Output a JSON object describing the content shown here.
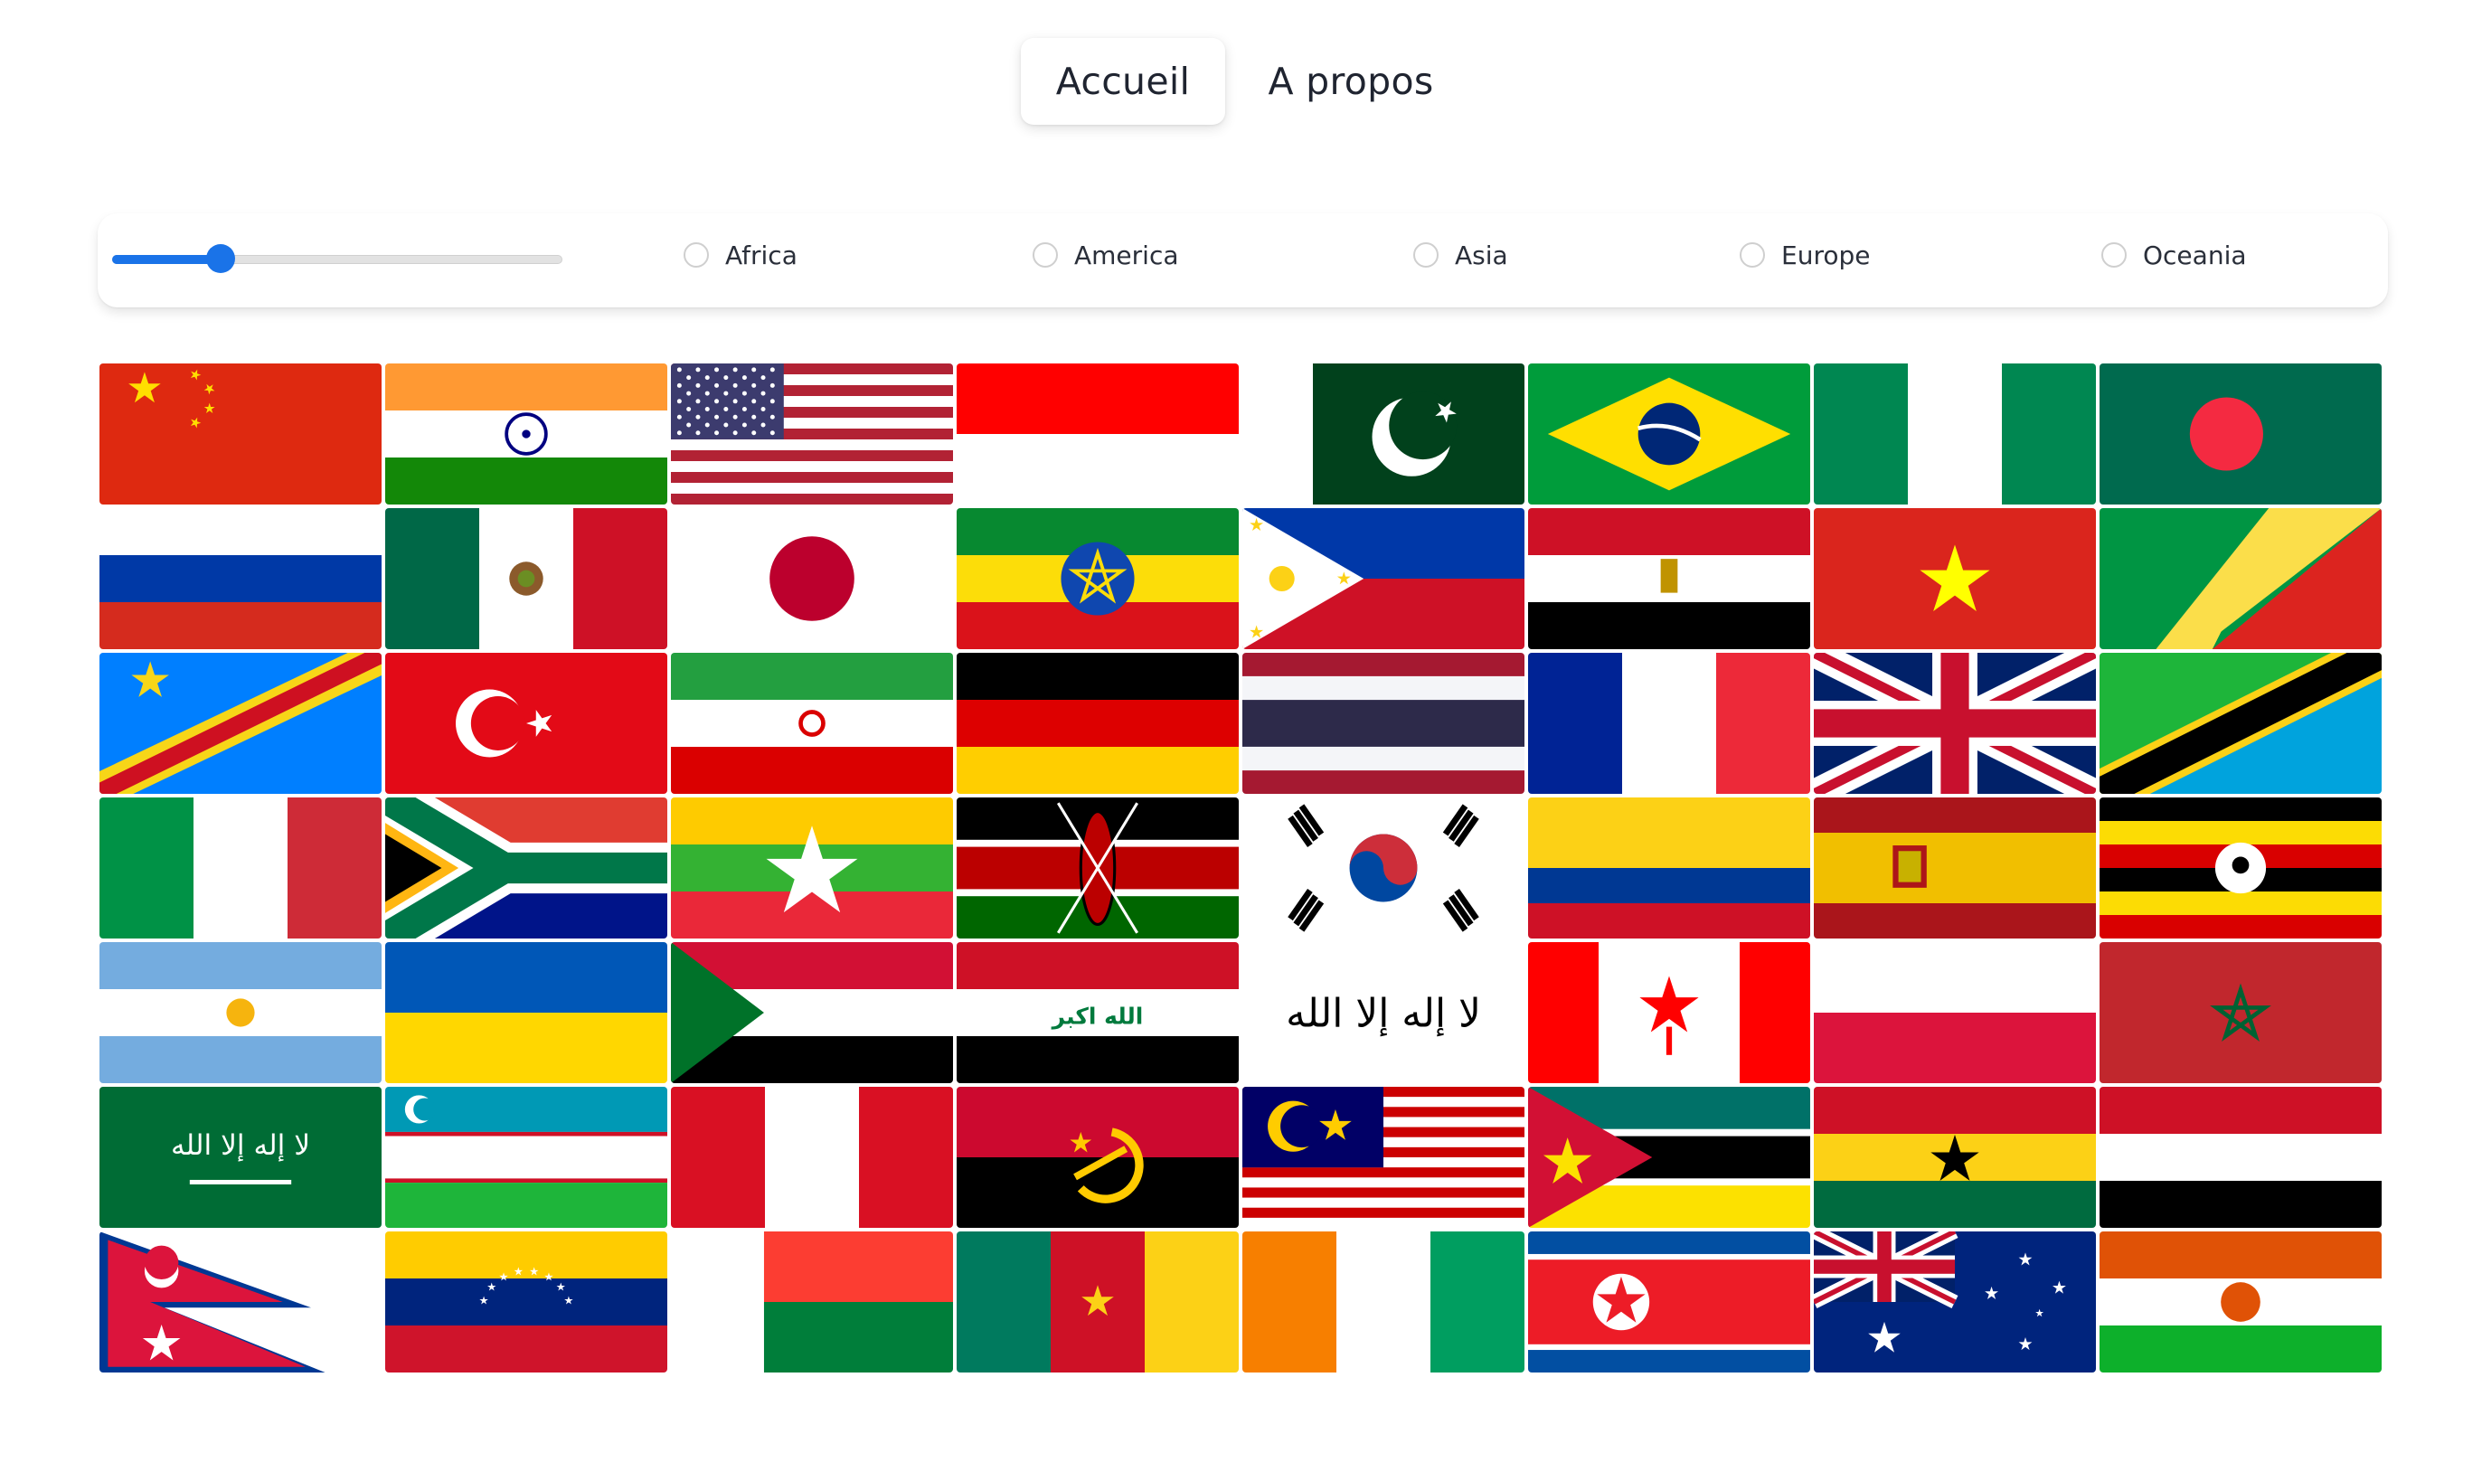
{
  "nav": {
    "home_label": "Accueil",
    "about_label": "A propos"
  },
  "filters": {
    "slider_level": 0.24,
    "regions": [
      {
        "label": "Africa",
        "checked": false
      },
      {
        "label": "America",
        "checked": false
      },
      {
        "label": "Asia",
        "checked": false
      },
      {
        "label": "Europe",
        "checked": false
      },
      {
        "label": "Oceania",
        "checked": false
      }
    ]
  },
  "flags": [
    "china",
    "india",
    "usa",
    "indonesia",
    "pakistan",
    "brazil",
    "nigeria",
    "bangladesh",
    "russia",
    "mexico",
    "japan",
    "ethiopia",
    "philippines",
    "egypt",
    "vietnam",
    "republic-of-congo",
    "dr-congo",
    "turkey",
    "iran",
    "germany",
    "thailand",
    "france",
    "united-kingdom",
    "tanzania",
    "italy",
    "south-africa",
    "myanmar",
    "kenya",
    "south-korea",
    "colombia",
    "spain",
    "uganda",
    "argentina",
    "ukraine",
    "sudan",
    "iraq",
    "afghanistan",
    "canada",
    "poland",
    "morocco",
    "saudi-arabia",
    "uzbekistan",
    "peru",
    "angola",
    "malaysia",
    "mozambique",
    "ghana",
    "yemen",
    "nepal",
    "venezuela",
    "madagascar",
    "cameroon",
    "ivory-coast",
    "north-korea",
    "australia",
    "niger"
  ]
}
